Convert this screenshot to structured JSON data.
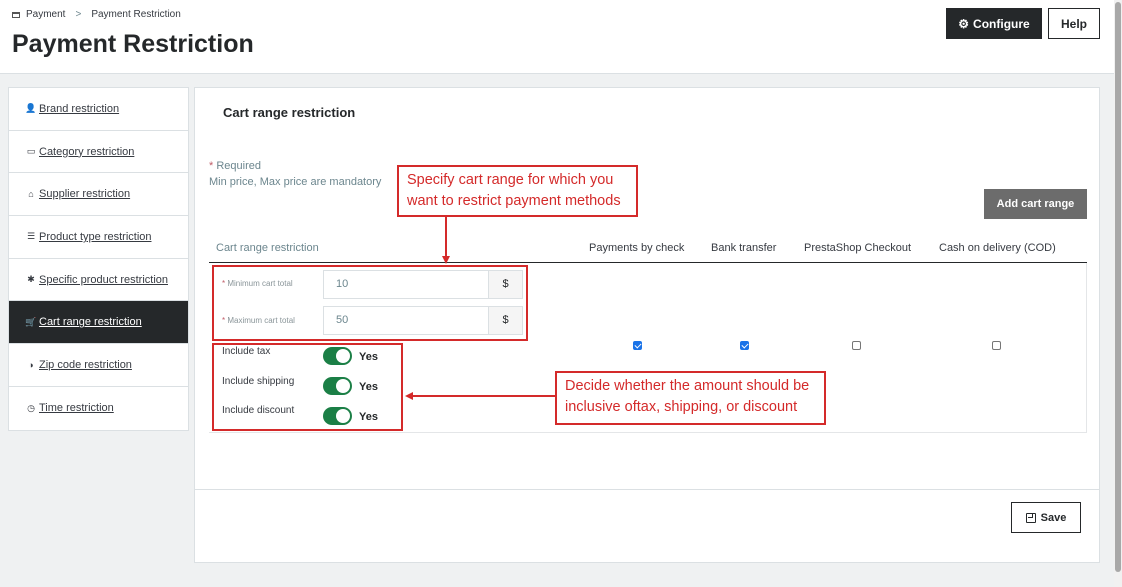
{
  "breadcrumb": {
    "parent": "Payment",
    "separator": ">",
    "current": "Payment Restriction"
  },
  "header": {
    "title": "Payment Restriction",
    "configure_label": "Configure",
    "help_label": "Help"
  },
  "sidebar": {
    "items": [
      {
        "label": "Brand restriction",
        "icon": "user-icon"
      },
      {
        "label": "Category restriction",
        "icon": "card-icon"
      },
      {
        "label": "Supplier restriction",
        "icon": "home-icon"
      },
      {
        "label": "Product type restriction",
        "icon": "list-icon"
      },
      {
        "label": "Specific product restriction",
        "icon": "asterisk-icon"
      },
      {
        "label": "Cart range restriction",
        "icon": "cart-icon",
        "active": true
      },
      {
        "label": "Zip code restriction",
        "icon": "half-circle-icon"
      },
      {
        "label": "Time restriction",
        "icon": "clock-icon"
      }
    ]
  },
  "panel": {
    "title": "Cart range restriction",
    "required_note": "Required",
    "mandatory_note": "Min price, Max price are mandatory",
    "add_button": "Add cart range",
    "columns": [
      "Cart range restriction",
      "Payments by check",
      "Bank transfer",
      "PrestaShop Checkout",
      "Cash on delivery (COD)"
    ],
    "min_label": "Minimum cart total",
    "min_value": "10",
    "max_label": "Maximum cart total",
    "max_value": "50",
    "currency": "$",
    "options": [
      {
        "label": "Include tax",
        "state": "Yes"
      },
      {
        "label": "Include shipping",
        "state": "Yes"
      },
      {
        "label": "Include discount",
        "state": "Yes"
      }
    ],
    "payments_checked": [
      true,
      true,
      false,
      false
    ],
    "save_label": "Save"
  },
  "annotations": {
    "range_callout_1": "Specify cart range for which you",
    "range_callout_2": "want to restrict payment methods",
    "amount_callout_1": "Decide whether the amount should be",
    "amount_callout_2": "inclusive oftax, shipping, or discount"
  },
  "colors": {
    "accent_dark": "#25282a",
    "toggle_on": "#1b7f46",
    "annotation": "#d42a2a",
    "checkbox": "#1a73e8"
  }
}
